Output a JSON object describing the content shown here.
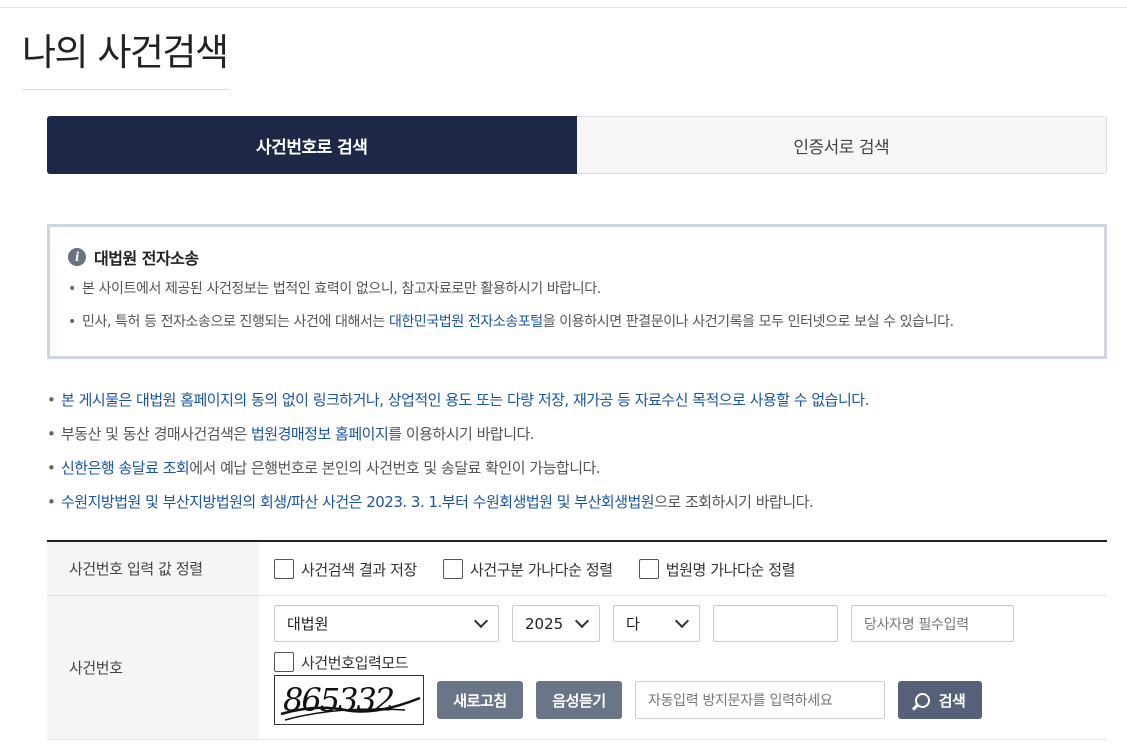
{
  "page": {
    "title": "나의 사건검색"
  },
  "tabs": [
    {
      "label": "사건번호로 검색",
      "active": true
    },
    {
      "label": "인증서로 검색",
      "active": false
    }
  ],
  "notice": {
    "title": "대법원 전자소송",
    "line1": "본 사이트에서 제공된 사건정보는 법적인 효력이 없으니, 참고자료로만 활용하시기 바랍니다.",
    "line2_pre": "민사, 특허 등 전자소송으로 진행되는 사건에 대해서는 ",
    "line2_link": "대한민국법원 전자소송포털",
    "line2_post": "을 이용하시면 판결문이나 사건기록을 모두 인터넷으로 보실 수 있습니다."
  },
  "guide": {
    "line1": "본 게시물은 대법원 홈페이지의 동의 없이 링크하거나, 상업적인 용도 또는 다량 저장, 재가공 등 자료수신 목적으로 사용할 수 없습니다.",
    "line2_pre": "부동산 및 동산 경매사건검색은 ",
    "line2_link": "법원경매정보 홈페이지",
    "line2_post": "를 이용하시기 바랍니다.",
    "line3_link": "신한은행 송달료 조회",
    "line3_post": "에서 예납 은행번호로 본인의 사건번호 및 송달료 확인이 가능합니다.",
    "line4_blue": "수원지방법원 및 부산지방법원의 회생/파산 사건은 2023. 3. 1.부터 수원회생법원 및 부산회생법원",
    "line4_post": "으로 조회하시기 바랍니다."
  },
  "form": {
    "sort_label": "사건번호 입력 값 정렬",
    "sort_options": [
      "사건검색 결과 저장",
      "사건구분 가나다순 정렬",
      "법원명 가나다순 정렬"
    ],
    "case_label": "사건번호",
    "court_select": "대법원",
    "year_select": "2025",
    "type_select": "다",
    "number_value": "",
    "party_placeholder": "당사자명 필수입력",
    "mode_label": "사건번호입력모드",
    "captcha_text": "865332",
    "refresh_label": "새로고침",
    "audio_label": "음성듣기",
    "captcha_placeholder": "자동입력 방지문자를 입력하세요",
    "search_label": "검색"
  },
  "colors": {
    "tab_active": "#1d2847",
    "link": "#1a54a8",
    "button": "#6b7588"
  }
}
